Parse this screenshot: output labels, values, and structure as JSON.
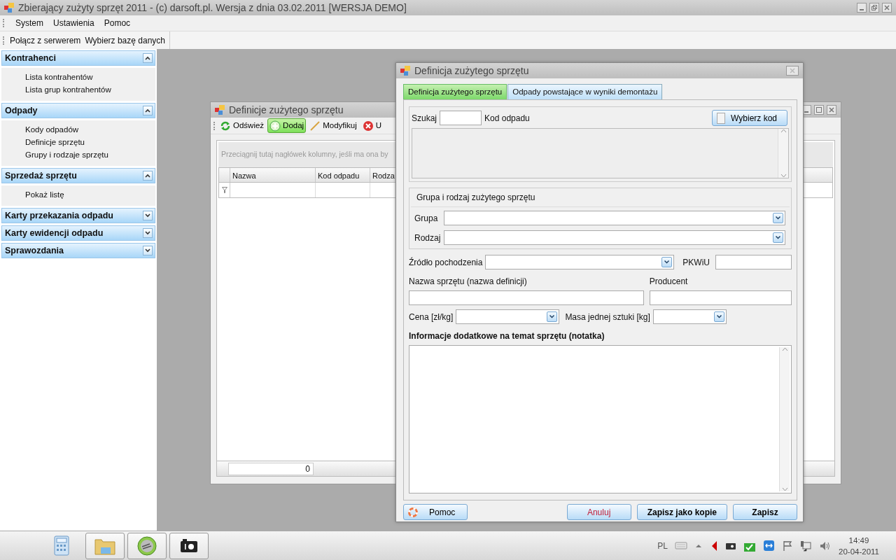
{
  "window": {
    "title": "Zbierający zużyty sprzęt 2011 - (c) darsoft.pl. Wersja z dnia 03.02.2011 [WERSJA DEMO]"
  },
  "menu": [
    "System",
    "Ustawienia",
    "Pomoc"
  ],
  "toolbar": [
    "Połącz z serwerem",
    "Wybierz bazę danych"
  ],
  "sidebar": [
    {
      "title": "Kontrahenci",
      "expanded": true,
      "items": [
        "Lista kontrahentów",
        "Lista grup kontrahentów"
      ]
    },
    {
      "title": "Odpady",
      "expanded": true,
      "items": [
        "Kody odpadów",
        "Definicje sprzętu",
        "Grupy i rodzaje sprzętu"
      ]
    },
    {
      "title": "Sprzedaż sprzętu",
      "expanded": true,
      "items": [
        "Pokaż listę"
      ]
    },
    {
      "title": "Karty przekazania odpadu",
      "expanded": false
    },
    {
      "title": "Karty ewidencji odpadu",
      "expanded": false
    },
    {
      "title": "Sprawozdania",
      "expanded": false
    }
  ],
  "list_window": {
    "title": "Definicje zużytego sprzętu",
    "toolbar": [
      {
        "label": "Odśwież",
        "kind": "refresh",
        "highlighted": false
      },
      {
        "label": "Dodaj",
        "kind": "add",
        "highlighted": true
      },
      {
        "label": "Modyfikuj",
        "kind": "edit",
        "highlighted": false
      },
      {
        "label": "U",
        "kind": "delete",
        "highlighted": false
      }
    ],
    "group_hint": "Przeciągnij tutaj nagłówek kolumny, jeśli ma ona by",
    "columns": [
      "Nazwa",
      "Kod odpadu",
      "Rodza"
    ],
    "row_count": "0"
  },
  "dialog": {
    "title": "Definicja zużytego sprzętu",
    "tabs": [
      {
        "label": "Definicja zużytego sprzętu",
        "selected": true
      },
      {
        "label": "Odpady powstające w wyniki demontażu",
        "selected": false
      }
    ],
    "search_label": "Szukaj",
    "code_label": "Kod odpadu",
    "pick_button": "Wybierz kod",
    "group_box": {
      "title": "Grupa i rodzaj zużytego sprzętu",
      "fields": [
        "Grupa",
        "Rodzaj"
      ]
    },
    "source_label": "Źródło pochodzenia",
    "pkwiu_label": "PKWiU",
    "name_label": "Nazwa sprzętu (nazwa definicji)",
    "producer_label": "Producent",
    "price_label": "Cena [zł/kg]",
    "mass_label": "Masa jednej sztuki [kg]",
    "notes_label": "Informacje dodatkowe na temat sprzętu (notatka)",
    "buttons": [
      {
        "label": "Pomoc",
        "kind": "help"
      },
      {
        "label": "Anuluj",
        "kind": "cancel"
      },
      {
        "label": "Zapisz jako kopie",
        "kind": "primary"
      },
      {
        "label": "Zapisz",
        "kind": "primary"
      }
    ]
  },
  "taskbar": {
    "apps": [
      {
        "kind": "calculator",
        "running": false
      },
      {
        "kind": "folder",
        "running": true
      },
      {
        "kind": "hand",
        "running": true
      },
      {
        "kind": "camera",
        "running": true
      }
    ],
    "tray": {
      "language": "PL",
      "time": "14:49",
      "date": "20-04-2011"
    }
  }
}
